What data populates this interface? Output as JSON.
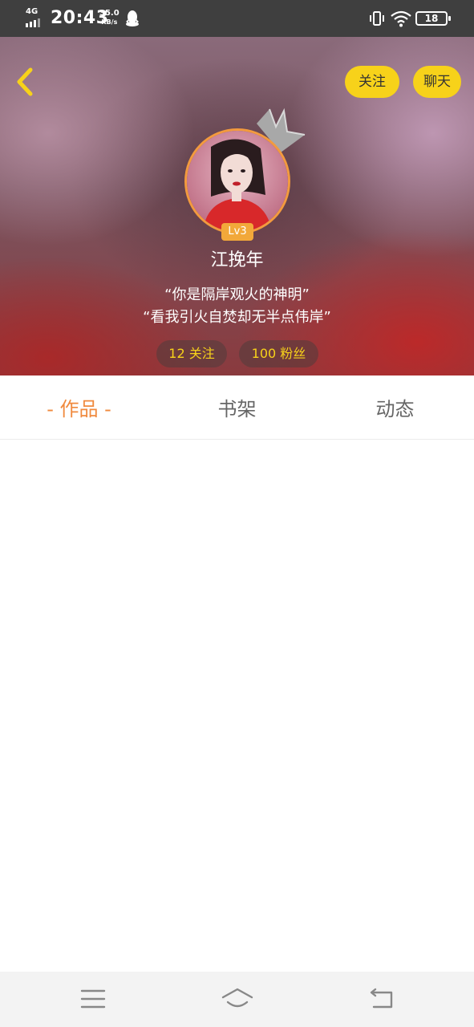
{
  "status_bar": {
    "network": "4G",
    "time": "20:43",
    "speed_value": "35.0",
    "speed_unit": "KB/s",
    "battery": "18"
  },
  "header": {
    "back_icon": "chevron-left-icon",
    "follow_label": "关注",
    "chat_label": "聊天"
  },
  "profile": {
    "level": "Lv3",
    "username": "江挽年",
    "bio_line1": "“你是隔岸观火的神明”",
    "bio_line2": "“看我引火自焚却无半点伟岸”",
    "following": "12 关注",
    "fans": "100 粉丝"
  },
  "tabs": {
    "works": "- 作品 -",
    "shelf": "书架",
    "moments": "动态"
  },
  "colors": {
    "accent_yellow": "#f7d21a",
    "active_tab": "#f08a3e",
    "level_badge": "#f2a83a"
  }
}
